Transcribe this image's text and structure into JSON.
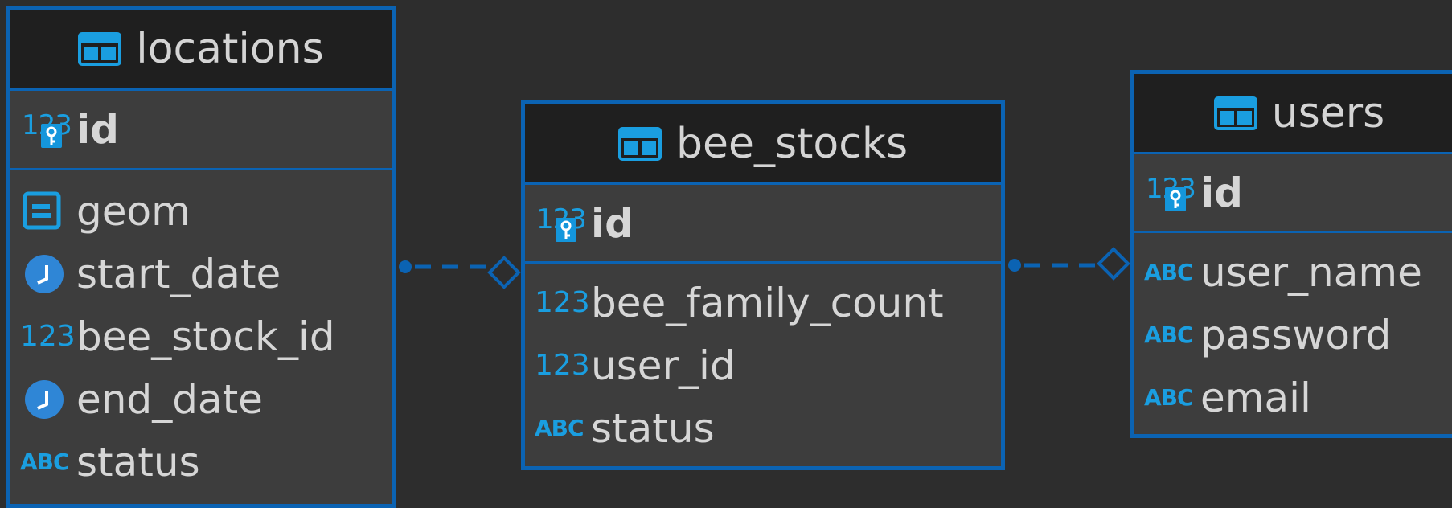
{
  "colors": {
    "background": "#2d2d2d",
    "border": "#0b63b3",
    "icon": "#1a9ee0",
    "text": "#d6d6d6",
    "header_bg": "#1f1f1f",
    "body_bg": "#3d3d3d"
  },
  "tables": {
    "locations": {
      "name": "locations",
      "pk": {
        "name": "id",
        "type_icon": "numeric-key-icon",
        "type_label": "123"
      },
      "columns": [
        {
          "name": "geom",
          "type_icon": "geometry-icon"
        },
        {
          "name": "start_date",
          "type_icon": "clock-icon"
        },
        {
          "name": "bee_stock_id",
          "type_icon": "numeric-icon",
          "type_label": "123"
        },
        {
          "name": "end_date",
          "type_icon": "clock-icon"
        },
        {
          "name": "status",
          "type_icon": "text-icon",
          "type_label": "ABC"
        }
      ]
    },
    "bee_stocks": {
      "name": "bee_stocks",
      "pk": {
        "name": "id",
        "type_icon": "numeric-key-icon",
        "type_label": "123"
      },
      "columns": [
        {
          "name": "bee_family_count",
          "type_icon": "numeric-icon",
          "type_label": "123"
        },
        {
          "name": "user_id",
          "type_icon": "numeric-icon",
          "type_label": "123"
        },
        {
          "name": "status",
          "type_icon": "text-icon",
          "type_label": "ABC"
        }
      ]
    },
    "users": {
      "name": "users",
      "pk": {
        "name": "id",
        "type_icon": "numeric-key-icon",
        "type_label": "123"
      },
      "columns": [
        {
          "name": "user_name",
          "type_icon": "text-icon",
          "type_label": "ABC"
        },
        {
          "name": "password",
          "type_icon": "text-icon",
          "type_label": "ABC"
        },
        {
          "name": "email",
          "type_icon": "text-icon",
          "type_label": "ABC"
        }
      ]
    }
  },
  "relations": [
    {
      "from": "locations",
      "to": "bee_stocks",
      "style": "dashed"
    },
    {
      "from": "bee_stocks",
      "to": "users",
      "style": "dashed"
    }
  ]
}
